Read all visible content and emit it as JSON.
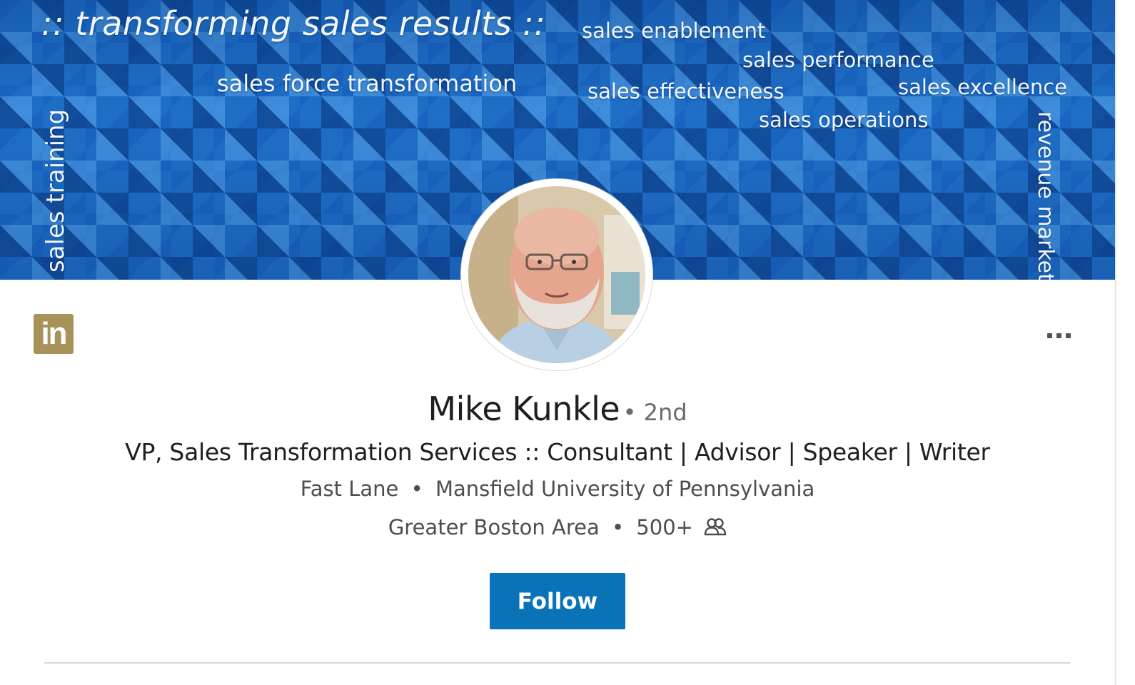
{
  "banner": {
    "headline": ":: transforming sales results ::",
    "phrases": [
      "sales enablement",
      "sales performance",
      "sales force transformation",
      "sales effectiveness",
      "sales excellence",
      "sales operations"
    ],
    "vertical_left": "sales training",
    "vertical_right": "revenue marketi"
  },
  "profile": {
    "name": "Mike Kunkle",
    "degree": "• 2nd",
    "headline": "VP, Sales Transformation Services :: Consultant | Advisor | Speaker | Writer",
    "company": "Fast Lane",
    "school": "Mansfield University of Pennsylvania",
    "location": "Greater Boston Area",
    "connections": "500+",
    "separator": "•"
  },
  "actions": {
    "follow_label": "Follow"
  },
  "logo": {
    "text": "in",
    "color": "#a8925a"
  },
  "colors": {
    "accent": "#0a73b8",
    "banner": "#1f6fc7"
  },
  "icons": {
    "more": "more-horizontal-icon",
    "connections": "people-icon",
    "logo": "linkedin-logo-icon"
  }
}
